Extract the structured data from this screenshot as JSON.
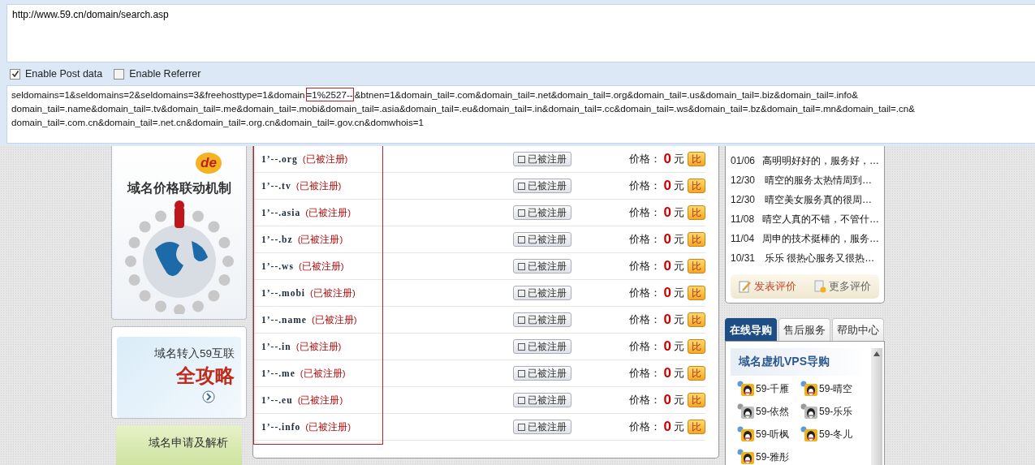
{
  "hackbar": {
    "url": "http://www.59.cn/domain/search.asp",
    "options": [
      {
        "label": "Enable Post data",
        "checked": true
      },
      {
        "label": "Enable Referrer",
        "checked": false
      }
    ],
    "post_lines": [
      [
        {
          "text": "seldomains=1&seldomains=2&seldomains=3&freehosttype=1&domain",
          "marked": false
        },
        {
          "text": "=1%2527--",
          "marked": true
        },
        {
          "text": "&btnen=1&domain_tail=.com&domain_tail=.net&domain_tail=.org&domain_tail=.us&domain_tail=.biz&domain_tail=.info&",
          "marked": false
        }
      ],
      [
        {
          "text": "domain_tail=.name&domain_tail=.tv&domain_tail=.me&domain_tail=.mobi&domain_tail=.asia&domain_tail=.eu&domain_tail=.in&domain_tail=.cc&domain_tail=.ws&domain_tail=.bz&domain_tail=.mn&domain_tail=.cn&",
          "marked": false
        }
      ],
      [
        {
          "text": "domain_tail=.com.cn&domain_tail=.net.cn&domain_tail=.org.cn&domain_tail=.gov.cn&domwhois=1",
          "marked": false
        }
      ]
    ]
  },
  "left_banners": [
    {
      "kind": "globe",
      "lines": [
        "de",
        "域名价格联动机制"
      ]
    },
    {
      "kind": "transfer",
      "lines": [
        "域名转入59互联",
        "全攻略"
      ]
    },
    {
      "kind": "sprout",
      "lines": [
        "域名申请及解析"
      ]
    }
  ],
  "results": {
    "highlighted": true,
    "rows": [
      {
        "domain": "1’--.org",
        "status": "(已被注册)",
        "button": "已被注册",
        "price_label": "价格：",
        "price": "0",
        "unit": "元",
        "compare": "比"
      },
      {
        "domain": "1’--.tv",
        "status": "(已被注册)",
        "button": "已被注册",
        "price_label": "价格：",
        "price": "0",
        "unit": "元",
        "compare": "比"
      },
      {
        "domain": "1’--.asia",
        "status": "(已被注册)",
        "button": "已被注册",
        "price_label": "价格：",
        "price": "0",
        "unit": "元",
        "compare": "比"
      },
      {
        "domain": "1’--.bz",
        "status": "(已被注册)",
        "button": "已被注册",
        "price_label": "价格：",
        "price": "0",
        "unit": "元",
        "compare": "比"
      },
      {
        "domain": "1’--.ws",
        "status": "(已被注册)",
        "button": "已被注册",
        "price_label": "价格：",
        "price": "0",
        "unit": "元",
        "compare": "比"
      },
      {
        "domain": "1’--.mobi",
        "status": "(已被注册)",
        "button": "已被注册",
        "price_label": "价格：",
        "price": "0",
        "unit": "元",
        "compare": "比"
      },
      {
        "domain": "1’--.name",
        "status": "(已被注册)",
        "button": "已被注册",
        "price_label": "价格：",
        "price": "0",
        "unit": "元",
        "compare": "比"
      },
      {
        "domain": "1’--.in",
        "status": "(已被注册)",
        "button": "已被注册",
        "price_label": "价格：",
        "price": "0",
        "unit": "元",
        "compare": "比"
      },
      {
        "domain": "1’--.me",
        "status": "(已被注册)",
        "button": "已被注册",
        "price_label": "价格：",
        "price": "0",
        "unit": "元",
        "compare": "比"
      },
      {
        "domain": "1’--.eu",
        "status": "(已被注册)",
        "button": "已被注册",
        "price_label": "价格：",
        "price": "0",
        "unit": "元",
        "compare": "比"
      },
      {
        "domain": "1’--.info",
        "status": "(已被注册)",
        "button": "已被注册",
        "price_label": "价格：",
        "price": "0",
        "unit": "元",
        "compare": "比"
      }
    ]
  },
  "reviews": {
    "items": [
      {
        "date": "01/06",
        "text": "高明明好好的，服务好，…"
      },
      {
        "date": "12/30",
        "text": "晴空的服务太热情周到…"
      },
      {
        "date": "12/30",
        "text": "晴空美女服务真的很周…"
      },
      {
        "date": "11/08",
        "text": "晴空人真的不错，不管什…"
      },
      {
        "date": "11/04",
        "text": "周申的技术挺棒的，服务…"
      },
      {
        "date": "10/31",
        "text": "乐乐 很热心服务又很热…"
      }
    ],
    "actions": [
      {
        "kind": "write",
        "label": "发表评价"
      },
      {
        "kind": "more",
        "label": "更多评价"
      }
    ]
  },
  "service": {
    "tabs": [
      {
        "label": "在线导购",
        "selected": true
      },
      {
        "label": "售后服务",
        "selected": false
      },
      {
        "label": "帮助中心",
        "selected": false
      }
    ],
    "heading": "域名虚机VPS导购",
    "contacts": [
      {
        "name": "59-千雁",
        "online": true
      },
      {
        "name": "59-晴空",
        "online": true
      },
      {
        "name": "59-依然",
        "online": false
      },
      {
        "name": "59-乐乐",
        "online": false
      },
      {
        "name": "59-听枫",
        "online": true
      },
      {
        "name": "59-冬儿",
        "online": true
      },
      {
        "name": "59-雅彤",
        "online": true
      }
    ]
  }
}
